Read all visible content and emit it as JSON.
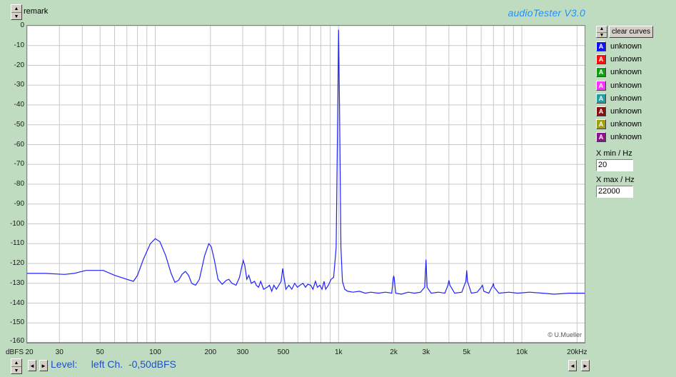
{
  "header": {
    "remark_label": "remark",
    "title": "audioTester  V3.0"
  },
  "controls": {
    "up_arrow": "▲",
    "down_arrow": "▼",
    "left_arrow": "◄",
    "right_arrow": "►",
    "clear_curves_label": "clear curves",
    "xmin_label": "X min / Hz",
    "xmin_value": "20",
    "xmax_label": "X max / Hz",
    "xmax_value": "22000"
  },
  "legend": [
    {
      "badge": "A",
      "label": "unknown",
      "color": "#1010ff"
    },
    {
      "badge": "A",
      "label": "unknown",
      "color": "#ff1010"
    },
    {
      "badge": "A",
      "label": "unknown",
      "color": "#10a010"
    },
    {
      "badge": "A",
      "label": "unknown",
      "color": "#ff30ff"
    },
    {
      "badge": "A",
      "label": "unknown",
      "color": "#20a0a0"
    },
    {
      "badge": "A",
      "label": "unknown",
      "color": "#8b1010"
    },
    {
      "badge": "A",
      "label": "unknown",
      "color": "#a0a010"
    },
    {
      "badge": "A",
      "label": "unknown",
      "color": "#901090"
    }
  ],
  "status": {
    "level_text": "Level:     left Ch.  -0,50dBFS"
  },
  "watermark": "© U.Mueller",
  "chart_data": {
    "type": "line",
    "xscale": "log",
    "xlim": [
      20,
      22000
    ],
    "ylim": [
      -160,
      0
    ],
    "ylabel": "dBFS",
    "xlabel": "20kHz",
    "grid": true,
    "y_ticks": [
      0,
      -10,
      -20,
      -30,
      -40,
      -50,
      -60,
      -70,
      -80,
      -90,
      -100,
      -110,
      -120,
      -130,
      -140,
      -150,
      -160
    ],
    "x_ticks": [
      {
        "value": 20,
        "label": "20"
      },
      {
        "value": 30,
        "label": "30"
      },
      {
        "value": 50,
        "label": "50"
      },
      {
        "value": 100,
        "label": "100"
      },
      {
        "value": 200,
        "label": "200"
      },
      {
        "value": 300,
        "label": "300"
      },
      {
        "value": 500,
        "label": "500"
      },
      {
        "value": 1000,
        "label": "1k"
      },
      {
        "value": 2000,
        "label": "2k"
      },
      {
        "value": 3000,
        "label": "3k"
      },
      {
        "value": 5000,
        "label": "5k"
      },
      {
        "value": 10000,
        "label": "10k"
      },
      {
        "value": 20000,
        "label": "20kHz"
      }
    ],
    "series": [
      {
        "color": "#2020ff",
        "points": [
          [
            20,
            -125
          ],
          [
            25,
            -125
          ],
          [
            32,
            -125.5
          ],
          [
            36,
            -125
          ],
          [
            42,
            -123.5
          ],
          [
            52,
            -123.5
          ],
          [
            60,
            -126
          ],
          [
            70,
            -128
          ],
          [
            76,
            -129
          ],
          [
            80,
            -126
          ],
          [
            86,
            -118
          ],
          [
            94,
            -110
          ],
          [
            100,
            -107.5
          ],
          [
            106,
            -109
          ],
          [
            114,
            -116
          ],
          [
            122,
            -125
          ],
          [
            128,
            -129.5
          ],
          [
            134,
            -128.5
          ],
          [
            140,
            -125.5
          ],
          [
            146,
            -124
          ],
          [
            152,
            -126
          ],
          [
            158,
            -130
          ],
          [
            166,
            -131
          ],
          [
            174,
            -128
          ],
          [
            186,
            -116
          ],
          [
            196,
            -110
          ],
          [
            202,
            -111.5
          ],
          [
            210,
            -118
          ],
          [
            220,
            -128
          ],
          [
            232,
            -130.5
          ],
          [
            244,
            -128.5
          ],
          [
            252,
            -128
          ],
          [
            262,
            -130
          ],
          [
            276,
            -131
          ],
          [
            288,
            -127
          ],
          [
            296,
            -122
          ],
          [
            302,
            -118.5
          ],
          [
            308,
            -121
          ],
          [
            316,
            -128
          ],
          [
            324,
            -126
          ],
          [
            334,
            -130
          ],
          [
            348,
            -129
          ],
          [
            356,
            -131
          ],
          [
            366,
            -132
          ],
          [
            376,
            -129
          ],
          [
            390,
            -133
          ],
          [
            408,
            -132
          ],
          [
            420,
            -131
          ],
          [
            432,
            -134
          ],
          [
            444,
            -131
          ],
          [
            458,
            -133
          ],
          [
            472,
            -131
          ],
          [
            486,
            -129
          ],
          [
            496,
            -122.5
          ],
          [
            504,
            -127
          ],
          [
            516,
            -133
          ],
          [
            536,
            -131
          ],
          [
            556,
            -133
          ],
          [
            576,
            -130
          ],
          [
            596,
            -132
          ],
          [
            616,
            -131
          ],
          [
            640,
            -130
          ],
          [
            660,
            -132
          ],
          [
            680,
            -130.5
          ],
          [
            705,
            -131
          ],
          [
            725,
            -133
          ],
          [
            748,
            -129
          ],
          [
            766,
            -132
          ],
          [
            790,
            -131
          ],
          [
            812,
            -133
          ],
          [
            834,
            -129
          ],
          [
            850,
            -133
          ],
          [
            880,
            -131
          ],
          [
            910,
            -128
          ],
          [
            940,
            -127
          ],
          [
            970,
            -112
          ],
          [
            990,
            -40
          ],
          [
            1000,
            -2
          ],
          [
            1012,
            -40
          ],
          [
            1030,
            -112
          ],
          [
            1050,
            -129
          ],
          [
            1080,
            -133
          ],
          [
            1120,
            -134
          ],
          [
            1200,
            -134.5
          ],
          [
            1300,
            -134
          ],
          [
            1400,
            -135
          ],
          [
            1500,
            -134.5
          ],
          [
            1650,
            -135
          ],
          [
            1800,
            -134.5
          ],
          [
            1950,
            -135
          ],
          [
            1990,
            -127
          ],
          [
            2000,
            -126.5
          ],
          [
            2010,
            -127
          ],
          [
            2050,
            -135
          ],
          [
            2200,
            -135.5
          ],
          [
            2400,
            -134.5
          ],
          [
            2600,
            -135
          ],
          [
            2800,
            -134.5
          ],
          [
            2950,
            -132
          ],
          [
            3000,
            -118
          ],
          [
            3040,
            -132
          ],
          [
            3200,
            -135
          ],
          [
            3500,
            -134.5
          ],
          [
            3800,
            -135
          ],
          [
            3950,
            -131
          ],
          [
            4000,
            -128.5
          ],
          [
            4050,
            -131
          ],
          [
            4300,
            -135
          ],
          [
            4700,
            -134.5
          ],
          [
            4950,
            -129
          ],
          [
            5000,
            -123.5
          ],
          [
            5050,
            -129
          ],
          [
            5300,
            -135
          ],
          [
            5700,
            -134.5
          ],
          [
            6000,
            -132
          ],
          [
            6100,
            -131
          ],
          [
            6200,
            -134
          ],
          [
            6600,
            -135
          ],
          [
            6950,
            -131
          ],
          [
            7000,
            -130
          ],
          [
            7050,
            -132
          ],
          [
            7500,
            -135
          ],
          [
            8500,
            -134.5
          ],
          [
            9500,
            -135
          ],
          [
            11000,
            -134.5
          ],
          [
            13000,
            -135
          ],
          [
            15000,
            -135.5
          ],
          [
            18000,
            -135
          ],
          [
            22000,
            -135
          ]
        ]
      },
      {
        "color": "#ff2020",
        "points": [
          [
            20,
            -160
          ],
          [
            22000,
            -160
          ]
        ]
      }
    ]
  }
}
